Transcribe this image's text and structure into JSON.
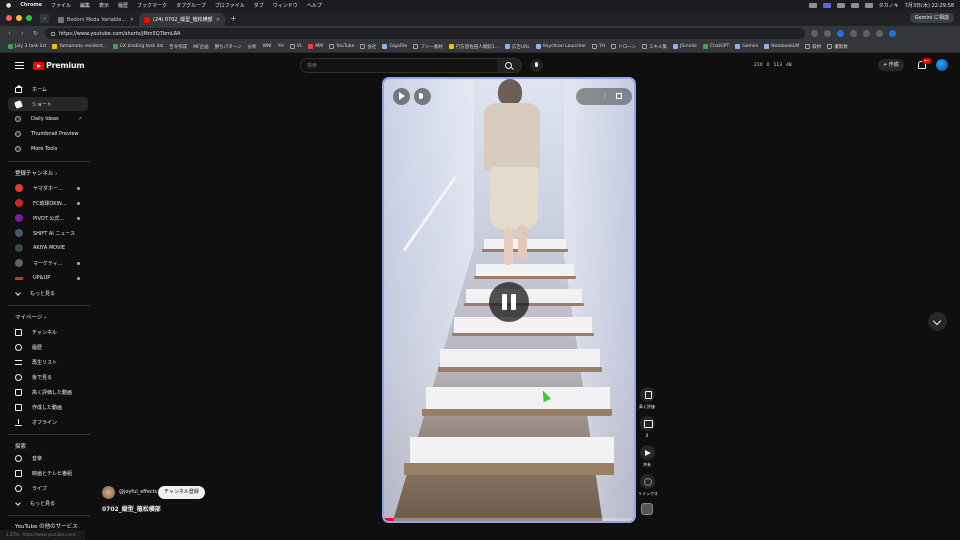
{
  "menubar": {
    "app": "Chrome",
    "items": [
      "ファイル",
      "編集",
      "表示",
      "履歴",
      "ブックマーク",
      "タブグループ",
      "プロファイル",
      "タブ",
      "ウィンドウ",
      "ヘルプ"
    ],
    "user": "タカノキ",
    "clock": "7月3日(木) 22:29:58"
  },
  "tabs": [
    {
      "label": "Bodoni Moda Variable | Adob",
      "active": false
    },
    {
      "label": "(24) 0702_縦型_植松横部",
      "active": true
    }
  ],
  "tabstrip": {
    "gemini_label": "Gemini に相談"
  },
  "address": {
    "url": "https://www.youtube.com/shorts/jMm5Q7bmLRA"
  },
  "bookmarks": [
    "July 3 task list",
    "Yamamoto resident...",
    "EX binding task list",
    "告令作成",
    "MF企画",
    "勝ちパターン",
    "分析",
    "WNI",
    "YH",
    "VL",
    "MM",
    "YouTube",
    "会社",
    "GigaFile",
    "フリー素材",
    "行方遊佐田人間館1...",
    "広告URL",
    "Keychron Launcher",
    "YH",
    "ドローン",
    "スキル集",
    "JSmints",
    "ChatGPT",
    "Gemini",
    "NotebookLM",
    "取材",
    "撮影数"
  ],
  "yt": {
    "brand": "Premium",
    "search_placeholder": "検索",
    "stats": [
      "210",
      "0",
      "113",
      "48"
    ],
    "create_label": "作成",
    "bell_badge": "9+"
  },
  "sidebar": {
    "main": [
      {
        "label": "ホーム",
        "icon": "home-icon"
      },
      {
        "label": "ショート",
        "icon": "shorts-icon",
        "active": true
      },
      {
        "label": "Daily Ideas",
        "icon": "ideas-icon",
        "external": true
      },
      {
        "label": "Thumbnail Preview",
        "icon": "thumbnail-icon"
      },
      {
        "label": "More Tools",
        "icon": "tools-icon"
      }
    ],
    "subs_heading": "登録チャンネル",
    "channels": [
      {
        "label": "ヤマダホームズ...",
        "color": "#e53935"
      },
      {
        "label": "FC琉球OKINAW...",
        "color": "#c62828"
      },
      {
        "label": "PIVOT 公式チャ...",
        "color": "#7b1fa2"
      },
      {
        "label": "SHIFT AI ニュース",
        "color": "#455a64"
      },
      {
        "label": "AKIYA MOVIE",
        "color": "#37474f"
      },
      {
        "label": "マーケティング...",
        "color": "#616161"
      },
      {
        "label": "UP&UP",
        "color": "#d32f2f"
      }
    ],
    "show_more": "もっと見る",
    "my_heading": "マイページ",
    "my": [
      {
        "label": "チャンネル",
        "icon": "channel-icon"
      },
      {
        "label": "履歴",
        "icon": "history-icon"
      },
      {
        "label": "再生リスト",
        "icon": "playlist-icon"
      },
      {
        "label": "後で見る",
        "icon": "watch-later-icon"
      },
      {
        "label": "高く評価した動画",
        "icon": "liked-icon"
      },
      {
        "label": "作成した動画",
        "icon": "your-videos-icon"
      },
      {
        "label": "オフライン",
        "icon": "download-icon"
      }
    ],
    "explore_heading": "探索",
    "explore": [
      {
        "label": "音楽",
        "icon": "music-icon"
      },
      {
        "label": "映画とテレビ番組",
        "icon": "movies-icon"
      },
      {
        "label": "ライブ",
        "icon": "live-icon"
      }
    ],
    "explore_more": "もっと見る",
    "services_heading": "YouTube の他のサービス"
  },
  "video": {
    "channel": "@joyful_effects",
    "subscribe_label": "チャンネル登録",
    "title": "0702_縦型_植松横部",
    "progress": 0.04
  },
  "actions": {
    "like_label": "高く評価",
    "comment_count": "0",
    "share_label": "共有",
    "remix_label": "リミックス"
  },
  "statusbar": {
    "text": "2.25%  ·  https://www.youtube.com/..."
  }
}
